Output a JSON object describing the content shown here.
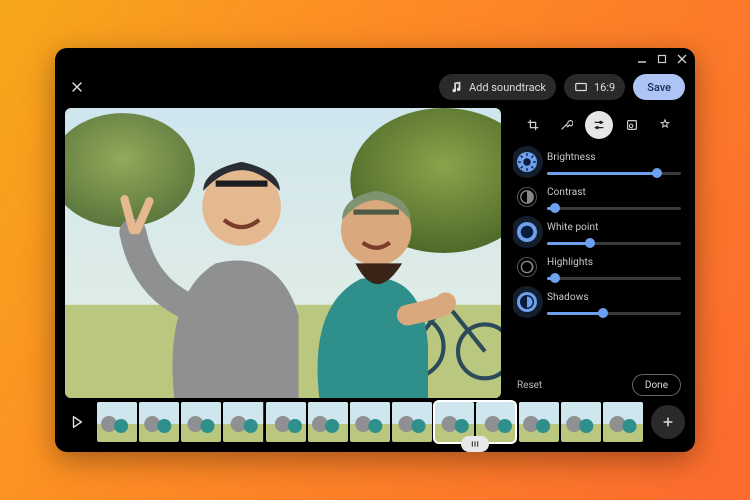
{
  "window": {
    "controls": {
      "minimize": "minimize-icon",
      "maximize": "maximize-icon",
      "close": "close-icon"
    }
  },
  "toolbar": {
    "close_icon": "close-icon",
    "add_soundtrack_label": "Add soundtrack",
    "aspect_label": "16:9",
    "save_label": "Save"
  },
  "tools": {
    "tabs": [
      {
        "icon": "crop-rotate-icon",
        "active": false
      },
      {
        "icon": "tools-icon",
        "active": false
      },
      {
        "icon": "sliders-icon",
        "active": true
      },
      {
        "icon": "filters-icon",
        "active": false
      },
      {
        "icon": "effects-icon",
        "active": false
      }
    ]
  },
  "adjust": {
    "items": [
      {
        "label": "Brightness",
        "value": 82,
        "active": true
      },
      {
        "label": "Contrast",
        "value": 6,
        "active": false
      },
      {
        "label": "White point",
        "value": 32,
        "active": true
      },
      {
        "label": "Highlights",
        "value": 6,
        "active": false
      },
      {
        "label": "Shadows",
        "value": 42,
        "active": true
      }
    ],
    "reset_label": "Reset",
    "done_label": "Done"
  },
  "timeline": {
    "play_icon": "play-icon",
    "frames": 13,
    "selection": {
      "start": 8,
      "end": 10
    },
    "add_icon": "plus-icon",
    "handle_icon": "grip-icon"
  },
  "colors": {
    "accent": "#6ea0f0",
    "save_bg": "#aec4f5"
  }
}
